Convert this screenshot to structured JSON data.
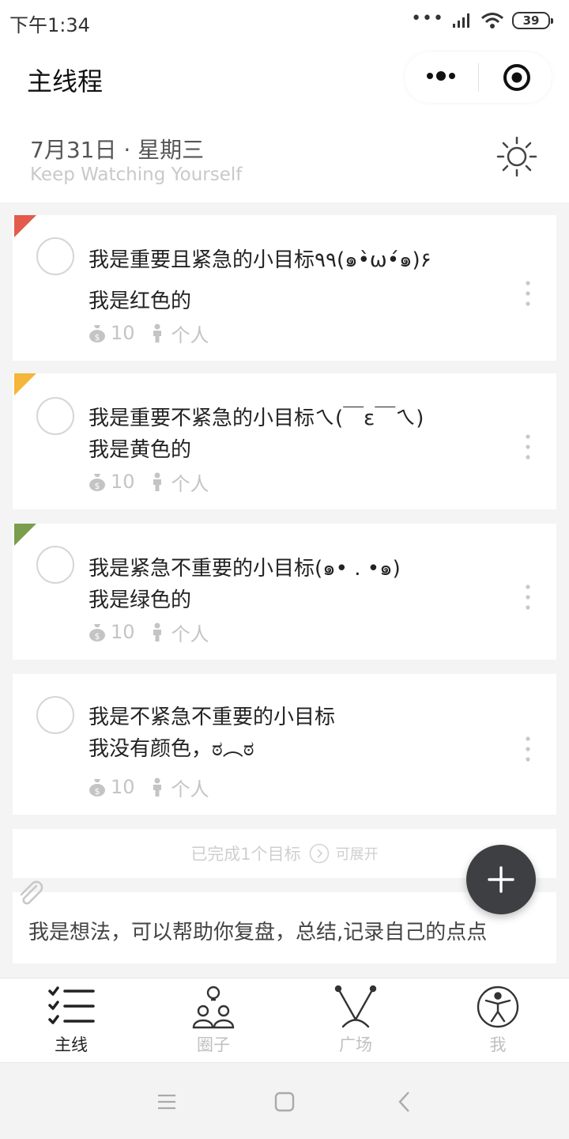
{
  "status_bar": {
    "time": "下午1:34",
    "battery": "39",
    "signal_dots": "•••"
  },
  "app": {
    "title": "主线程"
  },
  "date_header": {
    "date": "7月31日 · 星期三",
    "subtitle": "Keep Watching Yourself"
  },
  "goals": [
    {
      "title": "我是重要且紧急的小目标٩٩(๑•̀ω•́๑)۶",
      "desc": "我是红色的",
      "points": "10",
      "owner": "个人",
      "flag": "red",
      "flag_color": "#e25b4b"
    },
    {
      "title": "我是重要不紧急的小目标ㄟ(￣ε￣ㄟ)",
      "desc": "我是黄色的",
      "points": "10",
      "owner": "个人",
      "flag": "yellow",
      "flag_color": "#f5b63c"
    },
    {
      "title": "我是紧急不重要的小目标(๑• . •๑)",
      "desc": "我是绿色的",
      "points": "10",
      "owner": "个人",
      "flag": "green",
      "flag_color": "#7a9e4d"
    },
    {
      "title": "我是不紧急不重要的小目标",
      "desc": "我没有颜色，ಠ︵ಠ",
      "points": "10",
      "owner": "个人",
      "flag": "none"
    }
  ],
  "completed": {
    "label": "已完成1个目标",
    "expand": "可展开"
  },
  "thought": {
    "text": "我是想法，可以帮助你复盘，总结,记录自己的点点"
  },
  "tabs": [
    {
      "label": "主线",
      "icon": "checklist-icon",
      "active": true
    },
    {
      "label": "圈子",
      "icon": "group-idea-icon",
      "active": false
    },
    {
      "label": "广场",
      "icon": "antenna-icon",
      "active": false
    },
    {
      "label": "我",
      "icon": "accessibility-icon",
      "active": false
    }
  ],
  "colors": {
    "accent_dark": "#3e3f42",
    "background": "#f4f4f4",
    "muted": "#c4c4c4"
  }
}
